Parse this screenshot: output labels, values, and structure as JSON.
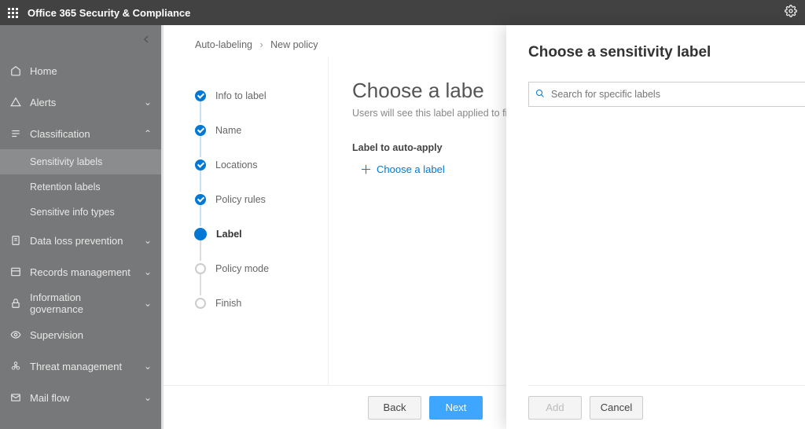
{
  "header": {
    "title": "Office 365 Security & Compliance"
  },
  "sidebar": {
    "items": [
      {
        "label": "Home",
        "icon": "home",
        "expandable": false
      },
      {
        "label": "Alerts",
        "icon": "alert",
        "expandable": true,
        "expanded": false
      },
      {
        "label": "Classification",
        "icon": "classification",
        "expandable": true,
        "expanded": true,
        "children": [
          {
            "label": "Sensitivity labels",
            "active": true
          },
          {
            "label": "Retention labels",
            "active": false
          },
          {
            "label": "Sensitive info types",
            "active": false
          }
        ]
      },
      {
        "label": "Data loss prevention",
        "icon": "dlp",
        "expandable": true,
        "expanded": false
      },
      {
        "label": "Records management",
        "icon": "records",
        "expandable": true,
        "expanded": false
      },
      {
        "label": "Information governance",
        "icon": "lock",
        "expandable": true,
        "expanded": false
      },
      {
        "label": "Supervision",
        "icon": "eye",
        "expandable": true,
        "expanded": false
      },
      {
        "label": "Threat management",
        "icon": "biohazard",
        "expandable": true,
        "expanded": false
      },
      {
        "label": "Mail flow",
        "icon": "mail",
        "expandable": true,
        "expanded": false
      }
    ]
  },
  "breadcrumb": {
    "root": "Auto-labeling",
    "current": "New policy"
  },
  "steps": [
    {
      "label": "Info to label",
      "state": "done"
    },
    {
      "label": "Name",
      "state": "done"
    },
    {
      "label": "Locations",
      "state": "done"
    },
    {
      "label": "Policy rules",
      "state": "done"
    },
    {
      "label": "Label",
      "state": "current"
    },
    {
      "label": "Policy mode",
      "state": "pending"
    },
    {
      "label": "Finish",
      "state": "pending"
    }
  ],
  "center": {
    "heading": "Choose a labe",
    "subtitle": "Users will see this label applied to fil",
    "section_label": "Label to auto-apply",
    "choose_link": "Choose a label"
  },
  "footer": {
    "back": "Back",
    "next": "Next"
  },
  "flyout": {
    "title": "Choose a sensitivity label",
    "search_placeholder": "Search for specific labels",
    "add": "Add",
    "cancel": "Cancel"
  }
}
